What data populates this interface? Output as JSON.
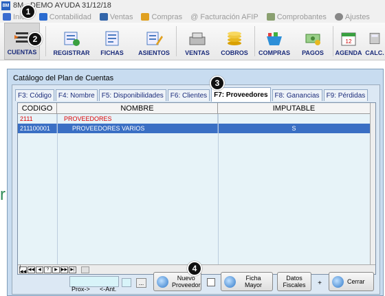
{
  "window": {
    "title": "8M - DEMO AYUDA 31/12/18",
    "app_icon_text": "8M"
  },
  "menu": [
    {
      "label": "Inicio",
      "icon": "home-icon",
      "color": "#3a6ccf"
    },
    {
      "label": "Contabilidad",
      "icon": "book-icon",
      "color": "#2a6bd0"
    },
    {
      "label": "Ventas",
      "icon": "sales-icon",
      "color": "#3366aa"
    },
    {
      "label": "Compras",
      "icon": "purchases-icon",
      "color": "#e0a020"
    },
    {
      "label": "@ Facturación AFIP",
      "icon": "afip-icon",
      "color": "#4a4a8a"
    },
    {
      "label": "Comprobantes",
      "icon": "documents-icon",
      "color": "#8aa070"
    },
    {
      "label": "Ajustes",
      "icon": "gear-icon",
      "color": "#888888"
    }
  ],
  "toolbar": [
    {
      "label": "CUENTAS",
      "icon": "accounts-icon",
      "active": true
    },
    {
      "label": "REGISTRAR",
      "icon": "register-icon"
    },
    {
      "label": "FICHAS",
      "icon": "cards-icon"
    },
    {
      "label": "ASIENTOS",
      "icon": "entries-icon"
    },
    {
      "label": "VENTAS",
      "icon": "cash-register-icon"
    },
    {
      "label": "COBROS",
      "icon": "coins-icon"
    },
    {
      "label": "COMPRAS",
      "icon": "basket-icon"
    },
    {
      "label": "PAGOS",
      "icon": "payments-icon"
    },
    {
      "label": "AGENDA",
      "icon": "calendar-icon"
    },
    {
      "label": "CALC.",
      "icon": "calculator-icon"
    }
  ],
  "dialog": {
    "title": "Catálogo del Plan de Cuentas",
    "tabs": [
      {
        "label": "F3: Código"
      },
      {
        "label": "F4: Nombre"
      },
      {
        "label": "F5: Disponibilidades"
      },
      {
        "label": "F6: Clientes"
      },
      {
        "label": "F7: Proveedores",
        "active": true
      },
      {
        "label": "F8: Ganancias"
      },
      {
        "label": "F9: Pérdidas"
      }
    ],
    "grid": {
      "columns": [
        "CODIGO",
        "NOMBRE",
        "IMPUTABLE"
      ],
      "rows": [
        {
          "codigo": "2111",
          "nombre": "PROVEEDORES",
          "imputable": "",
          "style": "header"
        },
        {
          "codigo": "211100001",
          "nombre": "PROVEEDORES VARIOS",
          "imputable": "S",
          "style": "selected"
        }
      ]
    },
    "navigator": [
      "|◀◀",
      "◀◀",
      "◀",
      "?",
      "▶",
      "▶▶",
      "▶|"
    ],
    "search": {
      "prox_label": "Prox->",
      "ant_label": "<-Ant.",
      "dots_label": "..."
    },
    "buttons": {
      "nuevo_proveedor": "Nuevo\nProveedor",
      "ficha_mayor": "Ficha\nMayor",
      "datos_fiscales": "Datos\nFiscales",
      "plus": "+",
      "cerrar": "Cerrar"
    }
  },
  "callouts": [
    "1",
    "2",
    "3",
    "4"
  ],
  "colors": {
    "selection": "#3a6fc4",
    "accent_text": "#1a2b7a",
    "header_row_text": "#dd0000"
  }
}
